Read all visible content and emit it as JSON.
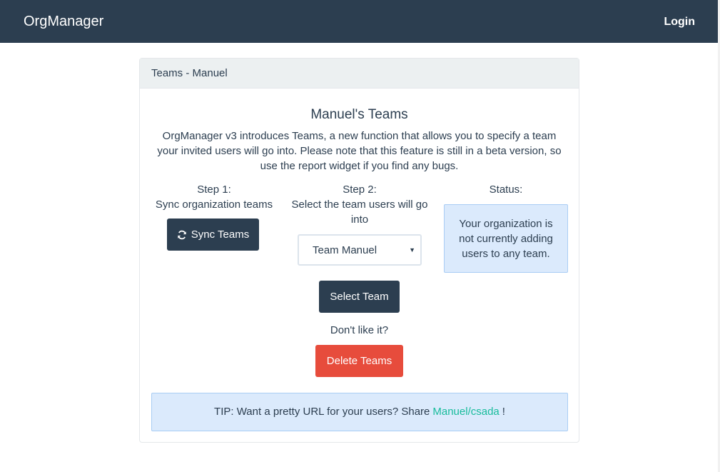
{
  "navbar": {
    "brand": "OrgManager",
    "login_label": "Login"
  },
  "panel": {
    "heading": "Teams - Manuel",
    "title": "Manuel's Teams",
    "intro": "OrgManager v3 introduces Teams, a new function that allows you to specify a team your invited users will go into. Please note that this feature is still in a beta version, so use the report widget if you find any bugs."
  },
  "step1": {
    "label_line1": "Step 1:",
    "label_line2": "Sync organization teams",
    "button_label": "Sync Teams",
    "button_icon": "refresh-icon"
  },
  "step2": {
    "label_line1": "Step 2:",
    "label_line2": "Select the team users will go into",
    "select_value": "Team Manuel",
    "select_button_label": "Select Team"
  },
  "status": {
    "label": "Status:",
    "message": "Your organization is not currently adding users to any team."
  },
  "delete": {
    "prompt": "Don't like it?",
    "button_label": "Delete Teams"
  },
  "tip": {
    "prefix": "TIP: Want a pretty URL for your users? Share",
    "link": "Manuel/csada",
    "suffix": "!"
  },
  "colors": {
    "navbar_bg": "#2c3e50",
    "button_dark": "#2c3e50",
    "button_danger": "#e74c3c",
    "info_bg": "#dbeafc",
    "link": "#18bc9c"
  }
}
